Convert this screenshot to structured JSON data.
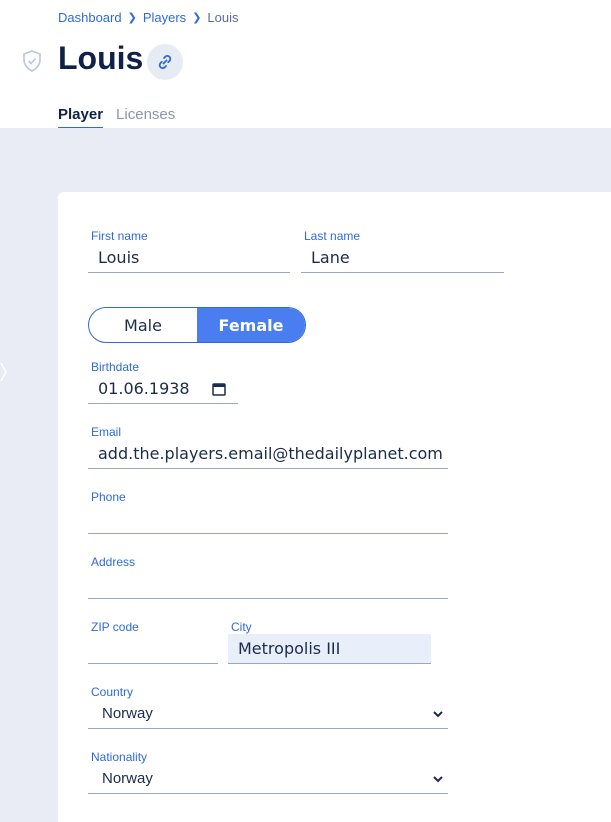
{
  "breadcrumb": [
    "Dashboard",
    "Players",
    "Louis"
  ],
  "page": {
    "title": "Louis"
  },
  "tabs": [
    {
      "label": "Player",
      "active": true
    },
    {
      "label": "Licenses",
      "active": false
    }
  ],
  "form": {
    "first_name": {
      "label": "First name",
      "value": "Louis"
    },
    "last_name": {
      "label": "Last name",
      "value": "Lane"
    },
    "gender": {
      "options": [
        "Male",
        "Female"
      ],
      "selected": "Female"
    },
    "birthdate": {
      "label": "Birthdate",
      "value": "01.06.1938"
    },
    "email": {
      "label": "Email",
      "value": "add.the.players.email@thedailyplanet.com"
    },
    "phone": {
      "label": "Phone",
      "value": ""
    },
    "address": {
      "label": "Address",
      "value": ""
    },
    "zip": {
      "label": "ZIP code",
      "value": ""
    },
    "city": {
      "label": "City",
      "value": "Metropolis III"
    },
    "country": {
      "label": "Country",
      "value": "Norway"
    },
    "nationality": {
      "label": "Nationality",
      "value": "Norway"
    }
  },
  "colors": {
    "accent": "#2e6ad8",
    "toggle_active": "#4a7ef0",
    "page_bg": "#e9ecf5",
    "title": "#0f2149"
  },
  "icons": [
    "shield-check-icon",
    "link-icon",
    "calendar-icon",
    "chevron-down-icon",
    "chevron-right-icon"
  ]
}
